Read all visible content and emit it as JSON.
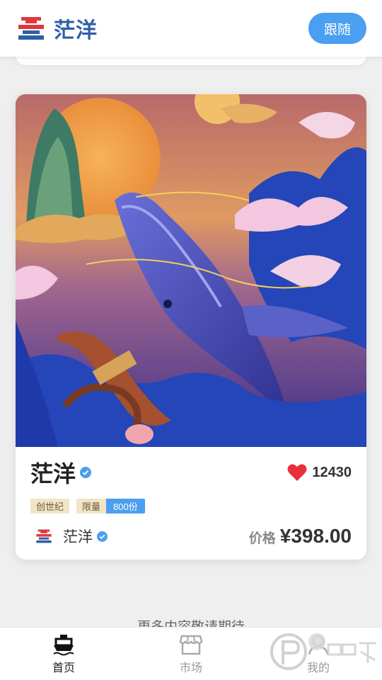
{
  "header": {
    "brand_name": "茫洋",
    "follow_label": "跟随"
  },
  "card": {
    "title": "茫洋",
    "likes": "12430",
    "tags": [
      "创世纪"
    ],
    "limited_label": "限量",
    "limited_count": "800份",
    "creator_name": "茫洋",
    "price_label": "价格",
    "price_value": "¥398.00"
  },
  "footer_text": "更多内容敬请期待",
  "tabs": [
    {
      "label": "首页",
      "icon": "ship-icon",
      "active": true
    },
    {
      "label": "市场",
      "icon": "store-icon",
      "active": false
    },
    {
      "label": "我的",
      "icon": "user-icon",
      "active": false
    }
  ],
  "watermark_text": "偏品下载",
  "colors": {
    "accent": "#4a9ff0",
    "brand": "#2f5ea6",
    "logo_red": "#e0383e",
    "tag_bg": "#f1e4c7",
    "heart": "#e8303a"
  }
}
